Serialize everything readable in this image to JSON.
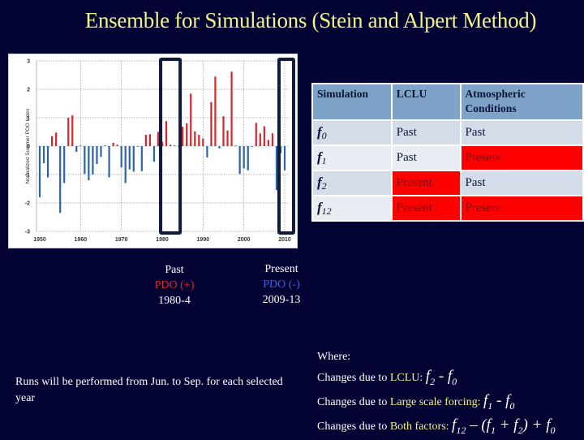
{
  "title": "Ensemble for Simulations (Stein and Alpert Method)",
  "past_label": {
    "line1": "Past",
    "line2": "PDO (+)",
    "line3": "1980-4"
  },
  "present_label": {
    "line1": "Present",
    "line2": "PDO (-)",
    "line3": "2009-13"
  },
  "colors": {
    "background": "#020333",
    "title": "#f2f28c",
    "positive_bar": "#d7262b",
    "negative_bar": "#2c64a8",
    "highlight_box": "#101a3a",
    "present_cell": "#ff0000",
    "header_cell": "#7ea2c8"
  },
  "table": {
    "headers": [
      "Simulation",
      "LCLU",
      "Atmospheric Conditions"
    ],
    "rows": [
      {
        "sim": "f",
        "sub": "0",
        "lclu": "Past",
        "atm": "Past"
      },
      {
        "sim": "f",
        "sub": "1",
        "lclu": "Past",
        "atm": "Present"
      },
      {
        "sim": "f",
        "sub": "2",
        "lclu": "Present",
        "atm": "Past"
      },
      {
        "sim": "f",
        "sub": "12",
        "lclu": "Present",
        "atm": "Present"
      }
    ]
  },
  "runs_note": "Runs will be performed from Jun. to Sep. for each selected year",
  "where": {
    "heading": "Where:",
    "lines": [
      {
        "prefix": "Changes due to ",
        "highlight": "LCLU:",
        "formula": "f2 - f0"
      },
      {
        "prefix": "Changes due to ",
        "highlight": "Large scale forcing:",
        "formula": "f1 - f0"
      },
      {
        "prefix": "Changes due to ",
        "highlight": "Both factors:",
        "formula": "f12 – (f1 + f2) + f0"
      }
    ]
  },
  "chart_data": {
    "type": "bar",
    "title": "",
    "xlabel": "",
    "ylabel": "Normalized Summer PDO Index",
    "ylim": [
      -3,
      3
    ],
    "xlim": [
      1950,
      2010
    ],
    "yticks": [
      "3",
      "2",
      "1",
      "0",
      "-1",
      "-2",
      "-3"
    ],
    "ytick_values": [
      3,
      2,
      1,
      0,
      -1,
      -2,
      -3
    ],
    "xticks": [
      "1950",
      "1960",
      "1970",
      "1980",
      "1990",
      "2000",
      "2010"
    ],
    "xtick_values": [
      1950,
      1960,
      1970,
      1980,
      1990,
      2000,
      2010
    ],
    "grid": true,
    "legend": "none",
    "x": [
      1950,
      1951,
      1952,
      1953,
      1954,
      1955,
      1956,
      1957,
      1958,
      1959,
      1960,
      1961,
      1962,
      1963,
      1964,
      1965,
      1966,
      1967,
      1968,
      1969,
      1970,
      1971,
      1972,
      1973,
      1974,
      1975,
      1976,
      1977,
      1978,
      1979,
      1980,
      1981,
      1982,
      1983,
      1984,
      1985,
      1986,
      1987,
      1988,
      1989,
      1990,
      1991,
      1992,
      1993,
      1994,
      1995,
      1996,
      1997,
      1998,
      1999,
      2000,
      2001,
      2002,
      2003,
      2004,
      2005,
      2006,
      2007,
      2008,
      2009,
      2010
    ],
    "values": [
      -1.8,
      -0.6,
      -1.1,
      0.35,
      0.48,
      -2.35,
      -1.3,
      1.0,
      1.08,
      -0.2,
      0.01,
      -0.98,
      -1.2,
      -1.0,
      -0.63,
      -0.38,
      0.03,
      -1.1,
      0.12,
      0.05,
      -0.75,
      -1.3,
      -0.82,
      -0.9,
      -0.02,
      -0.88,
      0.4,
      0.42,
      -0.55,
      0.5,
      0.15,
      0.88,
      0.05,
      0.0,
      -0.01,
      0.68,
      0.8,
      1.85,
      0.52,
      0.4,
      0.27,
      -0.4,
      1.55,
      2.45,
      -0.08,
      1.05,
      0.55,
      2.62,
      0.02,
      -0.98,
      -0.78,
      -0.85,
      -0.02,
      0.82,
      0.45,
      0.7,
      0.22,
      0.45,
      -1.55,
      -0.25,
      -0.85
    ],
    "highlight_ranges": [
      {
        "label": "Past PDO (+)",
        "from": 1980,
        "to": 1984
      },
      {
        "label": "Present PDO (-)",
        "from": 2009,
        "to": 2013
      }
    ]
  }
}
